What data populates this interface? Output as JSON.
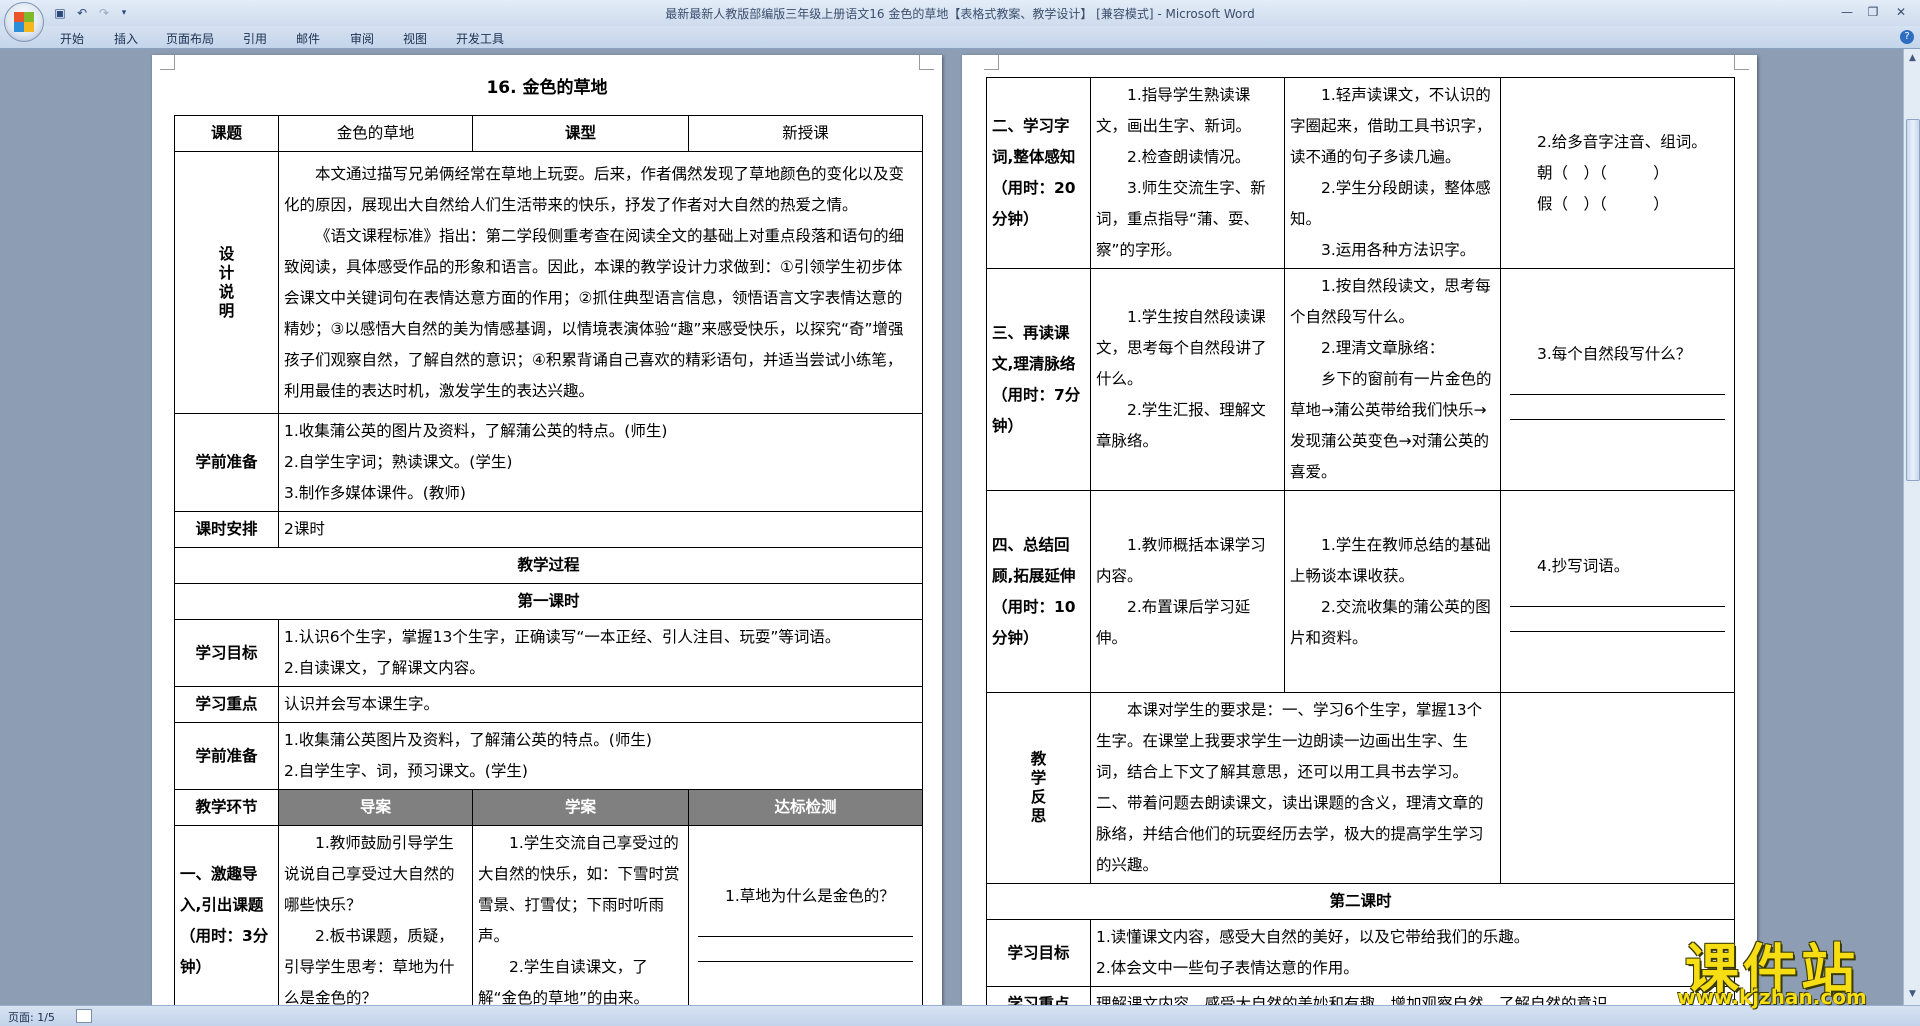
{
  "window": {
    "title": "最新最新人教版部编版三年级上册语文16 金色的草地【表格式教案、教学设计】 [兼容模式] - Microsoft Word",
    "controls": [
      "—",
      "❐",
      "✕"
    ]
  },
  "quick_access": {
    "save_icon": "save-icon",
    "undo_icon": "undo-icon",
    "redo_icon": "redo-icon",
    "customize_icon": "dropdown-icon"
  },
  "ribbon": {
    "tabs": [
      "开始",
      "插入",
      "页面布局",
      "引用",
      "邮件",
      "审阅",
      "视图",
      "开发工具"
    ]
  },
  "status": {
    "page": "页面: 1/5"
  },
  "watermark": {
    "text": "课件站",
    "url": "www.kjzhan.com",
    "color": "#f7dd14"
  },
  "page1": {
    "heading": "16. 金色的草地",
    "row_title": {
      "label": "课题",
      "value": "金色的草地",
      "type_label": "课型",
      "type_value": "新授课"
    },
    "design": {
      "label": "设计说明",
      "p1": "本文通过描写兄弟俩经常在草地上玩耍。后来，作者偶然发现了草地颜色的变化以及变化的原因，展现出大自然给人们生活带来的快乐，抒发了作者对大自然的热爱之情。",
      "p2": "《语文课程标准》指出：第二学段侧重考查在阅读全文的基础上对重点段落和语句的细致阅读，具体感受作品的形象和语言。因此，本课的教学设计力求做到：①引领学生初步体会课文中关键词句在表情达意方面的作用；②抓住典型语言信息，领悟语言文字表情达意的精妙；③以感悟大自然的美为情感基调，以情境表演体验“趣”来感受快乐，以探究“奇”增强孩子们观察自然，了解自然的意识；④积累背诵自己喜欢的精彩语句，并适当尝试小练笔，利用最佳的表达时机，激发学生的表达兴趣。"
    },
    "prep1": {
      "label": "学前准备",
      "items": [
        "1.收集蒲公英的图片及资料，了解蒲公英的特点。(师生)",
        "2.自学生字词；熟读课文。(学生)",
        "3.制作多媒体课件。(教师)"
      ]
    },
    "schedule": {
      "label": "课时安排",
      "value": "2课时"
    },
    "process": "教学过程",
    "lesson1": "第一课时",
    "goals": {
      "label": "学习目标",
      "items": [
        "1.认识6个生字，掌握13个生字，正确读写“一本正经、引人注目、玩耍”等词语。",
        "2.自读课文，了解课文内容。"
      ]
    },
    "focus": {
      "label": "学习重点",
      "value": "认识并会写本课生字。"
    },
    "prep2": {
      "label": "学前准备",
      "items": [
        "1.收集蒲公英图片及资料，了解蒲公英的特点。(师生)",
        "2.自学生字、词，预习课文。(学生)"
      ]
    },
    "headers": [
      "教学环节",
      "导案",
      "学案",
      "达标检测"
    ],
    "stage1": {
      "name": "一、激趣导入,引出课题（用时：3分钟）",
      "teacher": [
        "1.教师鼓励引导学生说说自己享受过大自然的哪些快乐？",
        "2.板书课题，质疑，引导学生思考：草地为什么是金色的？"
      ],
      "student": [
        "1.学生交流自己享受过的大自然的快乐，如：下雪时赏雪景、打雪仗；下雨时听雨声。",
        "2.学生自读课文，了解“金色的草地”的由来。"
      ],
      "check": "1.草地为什么是金色的？"
    }
  },
  "page2": {
    "stage2": {
      "name": "二、学习字词,整体感知（用时：20分钟）",
      "teacher": [
        "1.指导学生熟读课文，画出生字、新词。",
        "2.检查朗读情况。",
        "3.师生交流生字、新词，重点指导“蒲、耍、察”的字形。"
      ],
      "student": [
        "1.轻声读课文，不认识的字圈起来，借助工具书识字，读不通的句子多读几遍。",
        "2.学生分段朗读，整体感知。",
        "3.运用各种方法识字。"
      ],
      "check": [
        "2.给多音字注音、组词。",
        "朝（　）（　　　）",
        "假（　）（　　　）"
      ]
    },
    "stage3": {
      "name": "三、再读课文,理清脉络（用时：7分钟）",
      "teacher": [
        "1.学生按自然段读课文，思考每个自然段讲了什么。",
        "2.学生汇报、理解文章脉络。"
      ],
      "student": [
        "1.按自然段读文，思考每个自然段写什么。",
        "2.理清文章脉络：",
        "乡下的窗前有一片金色的草地→蒲公英带给我们快乐→发现蒲公英变色→对蒲公英的喜爱。"
      ],
      "check": "3.每个自然段写什么？"
    },
    "stage4": {
      "name": "四、总结回顾,拓展延伸（用时：10分钟）",
      "teacher": [
        "1.教师概括本课学习内容。",
        "2.布置课后学习延伸。"
      ],
      "student": [
        "1.学生在教师总结的基础上畅谈本课收获。",
        "2.交流收集的蒲公英的图片和资料。"
      ],
      "check": "4.抄写词语。"
    },
    "reflect": {
      "label": "教学反思",
      "text": "本课对学生的要求是：一、学习6个生字，掌握13个生字。在课堂上我要求学生一边朗读一边画出生字、生词，结合上下文了解其意思，还可以用工具书去学习。二、带着问题去朗读课文，读出课题的含义，理清文章的脉络，并结合他们的玩耍经历去学，极大的提高学生学习的兴趣。"
    },
    "lesson2": "第二课时",
    "goals2": {
      "label": "学习目标",
      "items": [
        "1.读懂课文内容，感受大自然的美好，以及它带给我们的乐趣。",
        "2.体会文中一些句子表情达意的作用。"
      ]
    },
    "focus2": {
      "label": "学习重点",
      "value": "理解课文内容，感受大自然的美妙和有趣，增加观察自然，了解自然的意识。"
    }
  }
}
